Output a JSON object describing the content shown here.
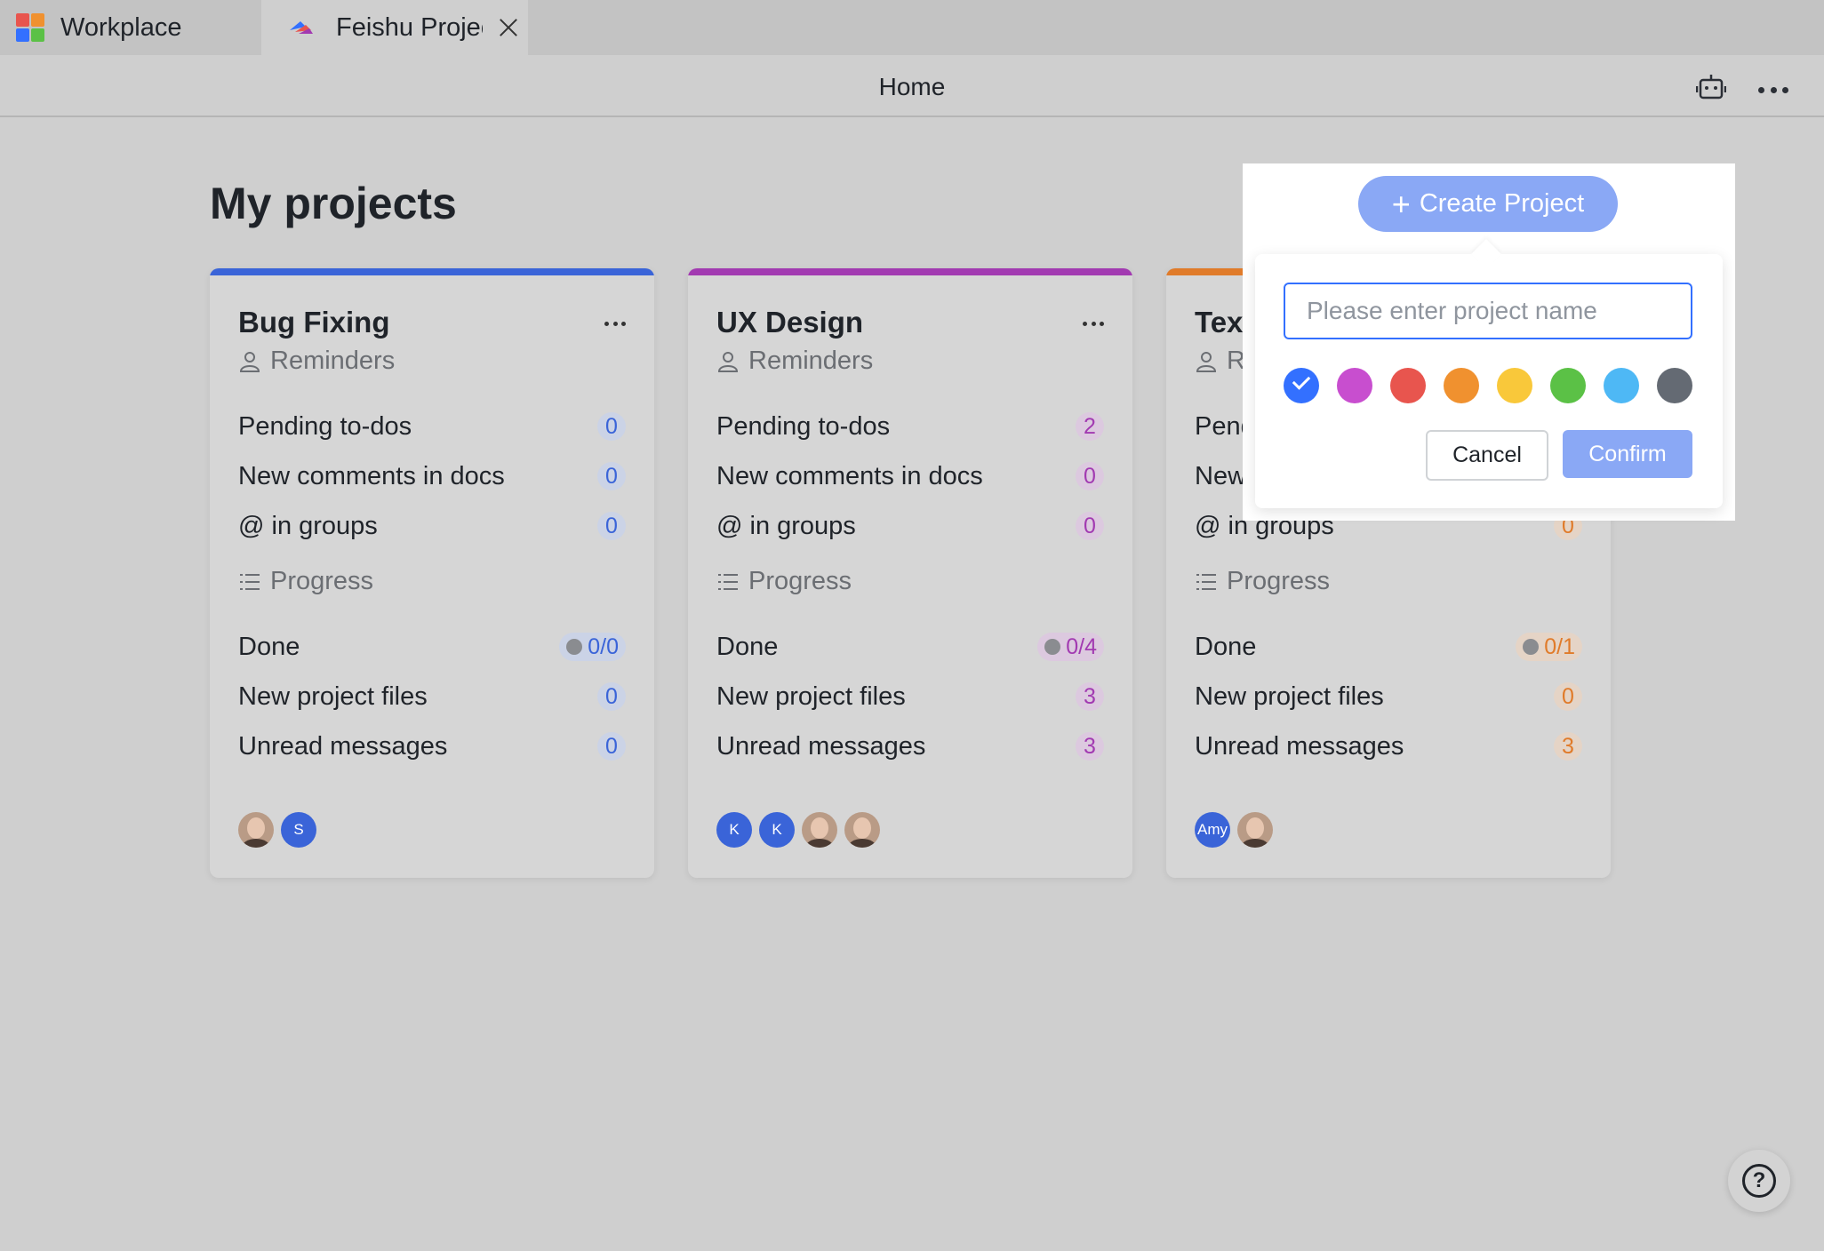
{
  "tabs": [
    {
      "label": "Workplace",
      "icon": "workplace-grid-icon"
    },
    {
      "label": "Feishu Project",
      "icon": "feishu-logo-icon",
      "active": true
    }
  ],
  "header": {
    "title": "Home",
    "icons": [
      "robot-icon",
      "more-icon"
    ]
  },
  "page": {
    "title": "My projects"
  },
  "section_labels": {
    "reminders": "Reminders",
    "progress": "Progress"
  },
  "row_labels": {
    "pending": "Pending to-dos",
    "comments": "New comments in docs",
    "groups": "@ in groups",
    "done": "Done",
    "files": "New project files",
    "messages": "Unread messages"
  },
  "projects": [
    {
      "name": "Bug Fixing",
      "color": "#3a64d8",
      "badge_bg": "#cbd3e6",
      "badge_fg": "#3a64d8",
      "pending": "0",
      "comments": "0",
      "groups": "0",
      "done": "0/0",
      "files": "0",
      "messages": "0",
      "avatars": [
        {
          "type": "photo",
          "label": ""
        },
        {
          "type": "initial",
          "label": "S",
          "color": "#3a64d8"
        }
      ]
    },
    {
      "name": "UX Design",
      "color": "#a23ab1",
      "badge_bg": "#dcc9df",
      "badge_fg": "#a23ab1",
      "pending": "2",
      "comments": "0",
      "groups": "0",
      "done": "0/4",
      "files": "3",
      "messages": "3",
      "avatars": [
        {
          "type": "initial",
          "label": "K",
          "color": "#3a64d8"
        },
        {
          "type": "initial",
          "label": "K",
          "color": "#3a64d8"
        },
        {
          "type": "photo",
          "label": ""
        },
        {
          "type": "photo",
          "label": ""
        }
      ]
    },
    {
      "name": "Text",
      "color": "#e07b2a",
      "badge_bg": "#e5d4c6",
      "badge_fg": "#e07b2a",
      "pending": "",
      "comments": "",
      "groups": "0",
      "done": "0/1",
      "files": "0",
      "messages": "3",
      "avatars": [
        {
          "type": "initial",
          "label": "Amy",
          "color": "#3a64d8"
        },
        {
          "type": "photo",
          "label": ""
        }
      ]
    }
  ],
  "create_project": {
    "button_label": "Create Project",
    "input_placeholder": "Please enter project name",
    "input_value": "",
    "colors": [
      "#3370ff",
      "#c84ecf",
      "#e8554e",
      "#f0912f",
      "#f9c83a",
      "#5bc146",
      "#4eb8f5",
      "#646a73"
    ],
    "selected_color_index": 0,
    "cancel_label": "Cancel",
    "confirm_label": "Confirm"
  }
}
